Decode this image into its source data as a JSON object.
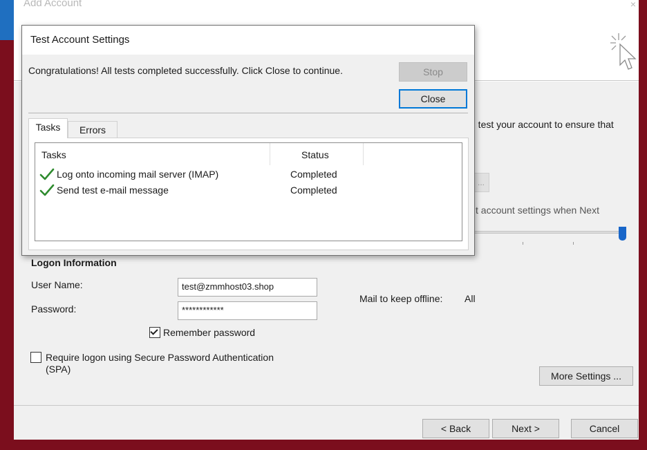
{
  "main_window": {
    "title": "Add Account",
    "close_glyph": "×",
    "bg_text_1": "u test your account to ensure that",
    "bg_test_button": "...",
    "bg_text_2": "t account settings when Next"
  },
  "logon": {
    "section_title": "Logon Information",
    "username_label": "User Name:",
    "username_value": "test@zmmhost03.shop",
    "password_label": "Password:",
    "password_value": "************",
    "remember_label": "Remember password",
    "remember_checked": true,
    "spa_label_line1": "Require logon using Secure Password Authentication",
    "spa_label_line2": "(SPA)",
    "spa_checked": false
  },
  "offline": {
    "label": "Mail to keep offline:",
    "value": "All",
    "level": 1.0
  },
  "more_settings_label": "More Settings ...",
  "footer": {
    "back_label": "< Back",
    "next_label": "Next >",
    "cancel_label": "Cancel"
  },
  "dialog": {
    "title": "Test Account Settings",
    "message": "Congratulations! All tests completed successfully. Click Close to continue.",
    "stop_label": "Stop",
    "close_label": "Close",
    "tabs": [
      {
        "label": "Tasks",
        "active": true
      },
      {
        "label": "Errors",
        "active": false
      }
    ],
    "columns": [
      "Tasks",
      "Status"
    ],
    "rows": [
      {
        "task": "Log onto incoming mail server (IMAP)",
        "status": "Completed"
      },
      {
        "task": "Send test e-mail message",
        "status": "Completed"
      }
    ]
  },
  "colors": {
    "frame": "#7b0e1d",
    "accent_blue": "#1866c9",
    "check_green": "#2e8b2e",
    "focus_border": "#0078d7"
  },
  "icons": [
    "wizard-sparkle-cursor-icon",
    "checkmark-icon",
    "close-icon"
  ]
}
